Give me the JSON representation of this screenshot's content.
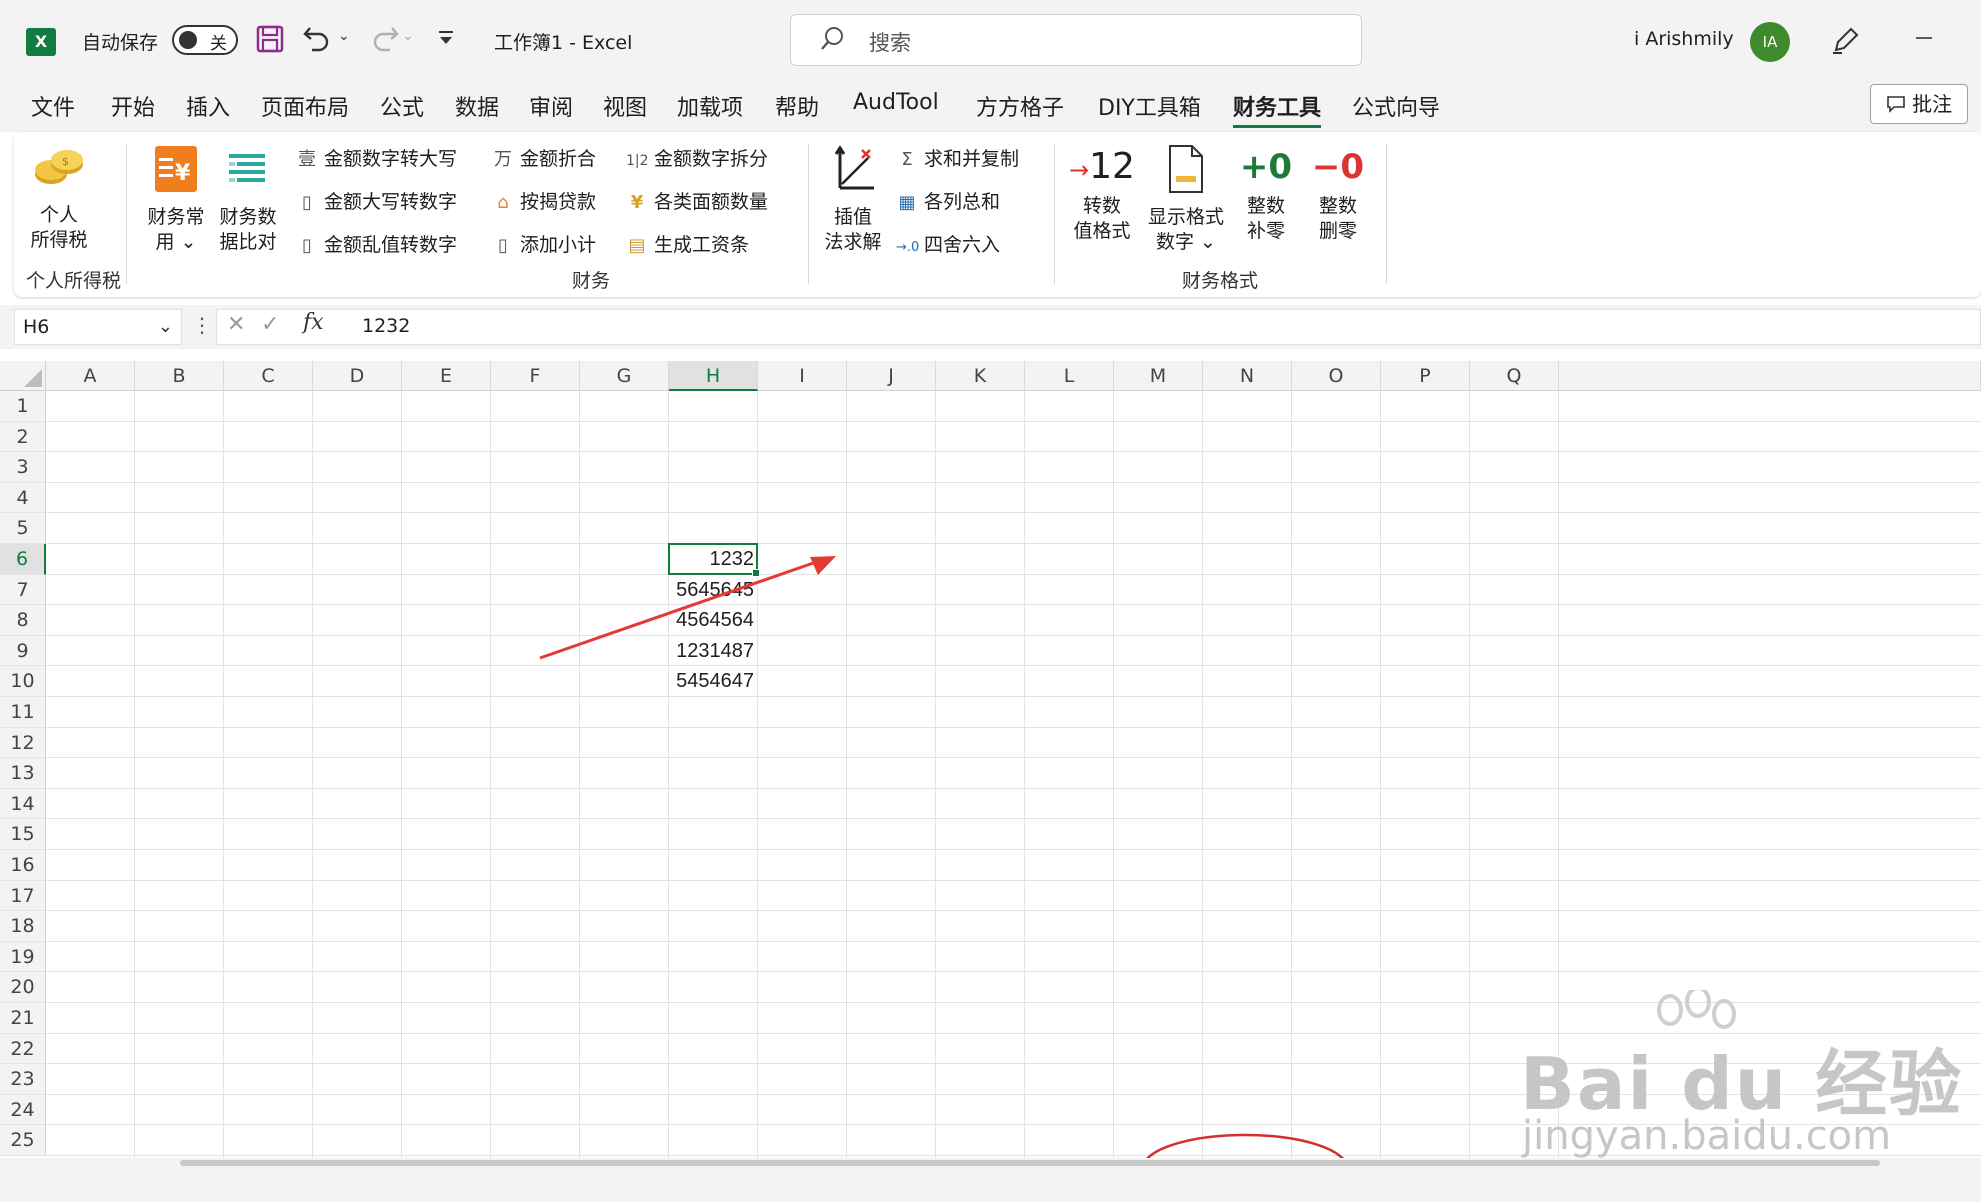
{
  "titlebar": {
    "autosave_label": "自动保存",
    "autosave_state": "关",
    "workbook_title": "工作簿1  -  Excel",
    "search_placeholder": "搜索",
    "user_name": "i Arishmily",
    "avatar_initials": "IA"
  },
  "menu": {
    "tabs": [
      "文件",
      "开始",
      "插入",
      "页面布局",
      "公式",
      "数据",
      "审阅",
      "视图",
      "加载项",
      "帮助",
      "AudTool",
      "方方格子",
      "DIY工具箱",
      "财务工具",
      "公式向导"
    ],
    "active_tab": "财务工具",
    "comment_button": "批注"
  },
  "ribbon": {
    "income_tax": {
      "label1": "个人",
      "label2": "所得税",
      "group": "个人所得税"
    },
    "finance_common": {
      "label1": "财务常",
      "label2": "用 ⌄"
    },
    "finance_compare": {
      "label1": "财务数",
      "label2": "据比对"
    },
    "col1": [
      "金额数字转大写",
      "金额大写转数字",
      "金额乱值转数字"
    ],
    "col2": [
      "金额折合",
      "按揭贷款",
      "添加小计"
    ],
    "col3": [
      "金额数字拆分",
      "各类面额数量",
      "生成工资条"
    ],
    "col1_icons": [
      "壹",
      "",
      ""
    ],
    "col2_icons": [
      "万",
      "",
      ""
    ],
    "col3_icons": [
      "1|2",
      "¥",
      ""
    ],
    "finance_group": "财务",
    "interp": {
      "label1": "插值",
      "label2": "法求解"
    },
    "col4": [
      "求和并复制",
      "各列总和",
      "四舍六入"
    ],
    "convert": {
      "icon": "→12",
      "label1": "转数",
      "label2": "值格式"
    },
    "display": {
      "label1": "显示格式",
      "label2": "数字 ⌄"
    },
    "pad": {
      "icon": "+0",
      "label1": "整数",
      "label2": "补零"
    },
    "trim": {
      "icon": "−0",
      "label1": "整数",
      "label2": "删零"
    },
    "format_group": "财务格式"
  },
  "formula_bar": {
    "name_box": "H6",
    "fx_label": "fx",
    "value": "1232"
  },
  "grid": {
    "columns": [
      "A",
      "B",
      "C",
      "D",
      "E",
      "F",
      "G",
      "H",
      "I",
      "J",
      "K",
      "L",
      "M",
      "N",
      "O",
      "P",
      "Q"
    ],
    "rows": [
      "1",
      "2",
      "3",
      "4",
      "5",
      "6",
      "7",
      "8",
      "9",
      "10",
      "11",
      "12",
      "13",
      "14",
      "15",
      "16",
      "17",
      "18",
      "19",
      "20",
      "21",
      "22",
      "23",
      "24",
      "25"
    ],
    "selected_column": "H",
    "selected_row": "6",
    "cells": [
      {
        "ref": "H6",
        "value": "1232"
      },
      {
        "ref": "H7",
        "value": "5645645"
      },
      {
        "ref": "H8",
        "value": "4564564"
      },
      {
        "ref": "H9",
        "value": "1231487"
      },
      {
        "ref": "H10",
        "value": "5454647"
      }
    ]
  },
  "annotations": {
    "arrow_color": "#e53935",
    "ellipse_color": "#d32f2f"
  },
  "watermark": {
    "text": "Bai du 经验",
    "url": "jingyan.baidu.com"
  },
  "colors": {
    "accent": "#107c41",
    "chrome_bg": "#f3f3f3"
  }
}
